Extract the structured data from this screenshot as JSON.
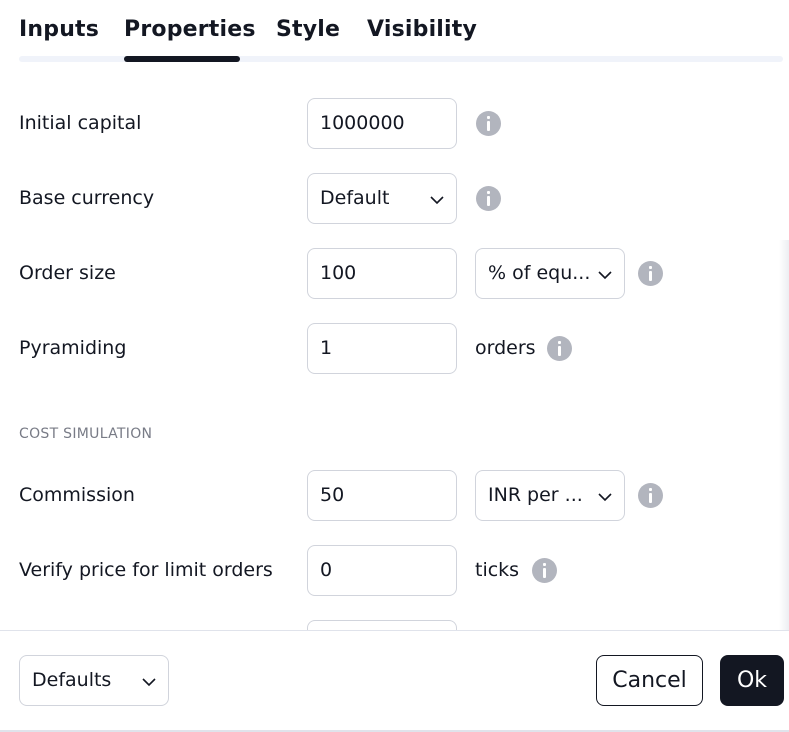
{
  "tabs": [
    {
      "label": "Inputs"
    },
    {
      "label": "Properties"
    },
    {
      "label": "Style"
    },
    {
      "label": "Visibility"
    }
  ],
  "active_tab": "Properties",
  "rows": {
    "initial_capital": {
      "label": "Initial capital",
      "value": "1000000"
    },
    "base_currency": {
      "label": "Base currency",
      "value": "Default"
    },
    "order_size": {
      "label": "Order size",
      "value": "100",
      "unit_value": "% of equ..."
    },
    "pyramiding": {
      "label": "Pyramiding",
      "value": "1",
      "unit": "orders"
    },
    "commission": {
      "label": "Commission",
      "value": "50",
      "unit_value": "INR per ..."
    },
    "verify_price": {
      "label": "Verify price for limit orders",
      "value": "0",
      "unit": "ticks"
    }
  },
  "section": {
    "cost_simulation": "COST SIMULATION"
  },
  "footer": {
    "defaults_label": "Defaults",
    "cancel_label": "Cancel",
    "ok_label": "Ok"
  },
  "icons": {
    "info": "info-icon",
    "chevron": "chevron-down-icon"
  },
  "colors": {
    "text": "#131722",
    "border": "#d1d4dc",
    "info_icon": "#b2b5be",
    "section_title": "#787b86",
    "primary_button": "#131722"
  }
}
